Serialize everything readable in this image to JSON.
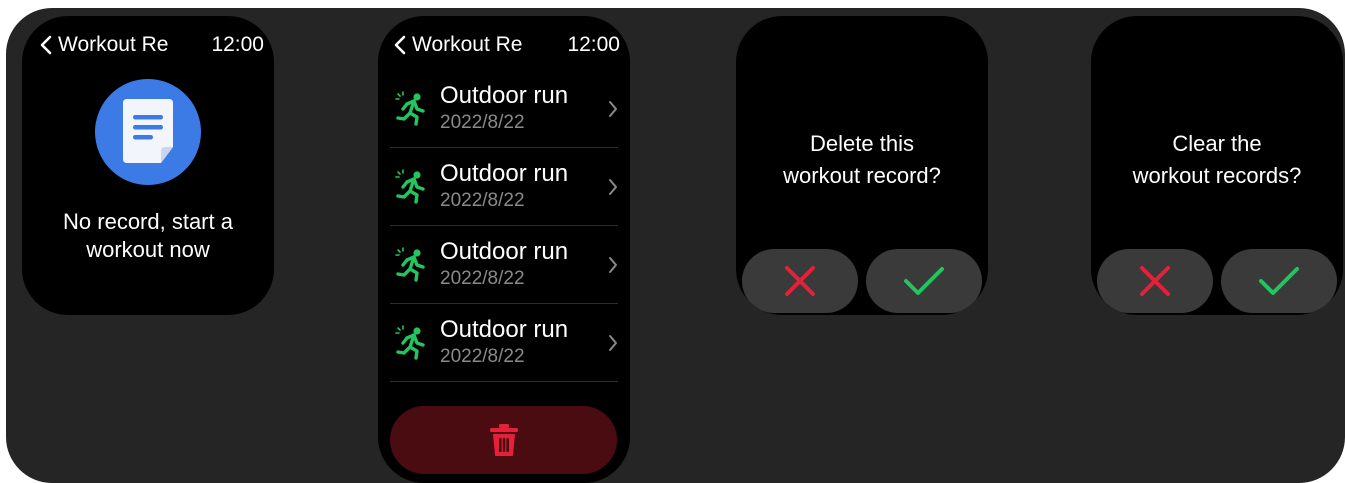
{
  "colors": {
    "background": "#252525",
    "accent_blue": "#3c7be6",
    "run_green": "#22c55e",
    "danger_red": "#e5213a",
    "delete_bar": "#4a0c10"
  },
  "screen_empty": {
    "back_label": "Workout Re",
    "time": "12:00",
    "icon": "document-icon",
    "message_line1": "No record, start a",
    "message_line2": "workout now"
  },
  "screen_list": {
    "back_label": "Workout Re",
    "time": "12:00",
    "records": [
      {
        "title": "Outdoor run",
        "date": "2022/8/22",
        "icon": "running-icon"
      },
      {
        "title": "Outdoor run",
        "date": "2022/8/22",
        "icon": "running-icon"
      },
      {
        "title": "Outdoor run",
        "date": "2022/8/22",
        "icon": "running-icon"
      },
      {
        "title": "Outdoor run",
        "date": "2022/8/22",
        "icon": "running-icon"
      }
    ],
    "delete_icon": "trash-icon"
  },
  "screen_delete": {
    "line1": "Delete this",
    "line2": "workout record?",
    "cancel_icon": "x-icon",
    "confirm_icon": "check-icon"
  },
  "screen_clear": {
    "line1": "Clear the",
    "line2": "workout records?",
    "cancel_icon": "x-icon",
    "confirm_icon": "check-icon"
  }
}
